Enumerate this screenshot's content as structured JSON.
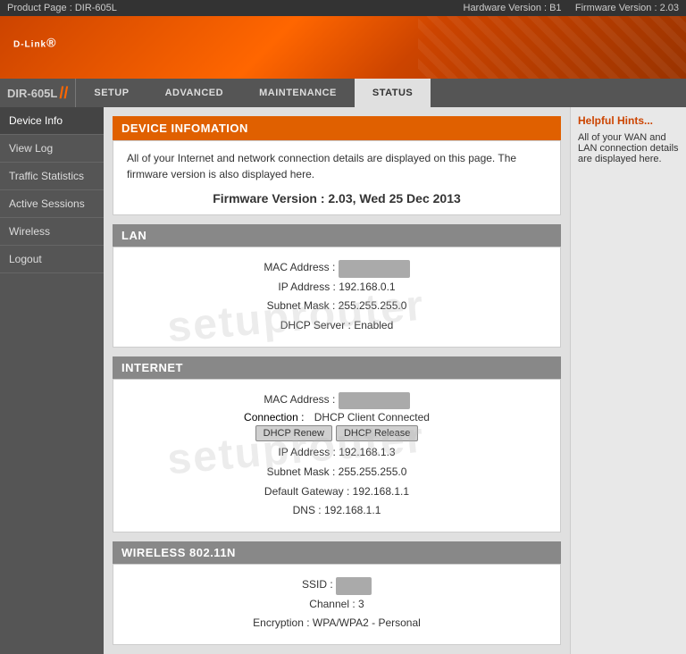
{
  "topbar": {
    "product": "Product Page : DIR-605L",
    "hardware": "Hardware Version : B1",
    "firmware_version": "Firmware Version : 2.03"
  },
  "header": {
    "logo": "D-Link",
    "logo_sup": "®"
  },
  "model": {
    "name": "DIR-605L",
    "slashes": "//"
  },
  "nav": {
    "tabs": [
      {
        "id": "setup",
        "label": "SETUP"
      },
      {
        "id": "advanced",
        "label": "ADVANCED"
      },
      {
        "id": "maintenance",
        "label": "MAINTENANCE"
      },
      {
        "id": "status",
        "label": "STATUS",
        "active": true
      }
    ]
  },
  "sidebar": {
    "items": [
      {
        "id": "device-info",
        "label": "Device Info",
        "active": true
      },
      {
        "id": "view-log",
        "label": "View Log"
      },
      {
        "id": "traffic-statistics",
        "label": "Traffic Statistics"
      },
      {
        "id": "active-sessions",
        "label": "Active Sessions"
      },
      {
        "id": "wireless",
        "label": "Wireless"
      },
      {
        "id": "logout",
        "label": "Logout"
      }
    ]
  },
  "device_info": {
    "section_title": "DEVICE INFOMATION",
    "description": "All of your Internet and network connection details are displayed on this page. The firmware version is also displayed here.",
    "firmware_label": "Firmware Version : 2.03,  Wed 25 Dec 2013"
  },
  "lan": {
    "section_title": "LAN",
    "mac_label": "MAC Address :",
    "mac_value": "██████████████",
    "ip_label": "IP Address :",
    "ip_value": "192.168.0.1",
    "subnet_label": "Subnet Mask :",
    "subnet_value": "255.255.255.0",
    "dhcp_label": "DHCP Server :",
    "dhcp_value": "Enabled"
  },
  "internet": {
    "section_title": "INTERNET",
    "mac_label": "MAC Address :",
    "mac_value": "██████████████",
    "connection_label": "Connection :",
    "connection_value": "DHCP Client Connected",
    "btn_renew": "DHCP Renew",
    "btn_release": "DHCP Release",
    "ip_label": "IP Address :",
    "ip_value": "192.168.1.3",
    "subnet_label": "Subnet Mask :",
    "subnet_value": "255.255.255.0",
    "gateway_label": "Default Gateway :",
    "gateway_value": "192.168.1.1",
    "dns_label": "DNS :",
    "dns_value": "192.168.1.1"
  },
  "wireless": {
    "section_title": "WIRELESS 802.11N",
    "ssid_label": "SSID :",
    "ssid_value": "████",
    "channel_label": "Channel :",
    "channel_value": "3",
    "encryption_label": "Encryption :",
    "encryption_value": "WPA/WPA2 - Personal"
  },
  "hints": {
    "title": "Helpful Hints...",
    "text": "All of your WAN and LAN connection details are displayed here."
  }
}
